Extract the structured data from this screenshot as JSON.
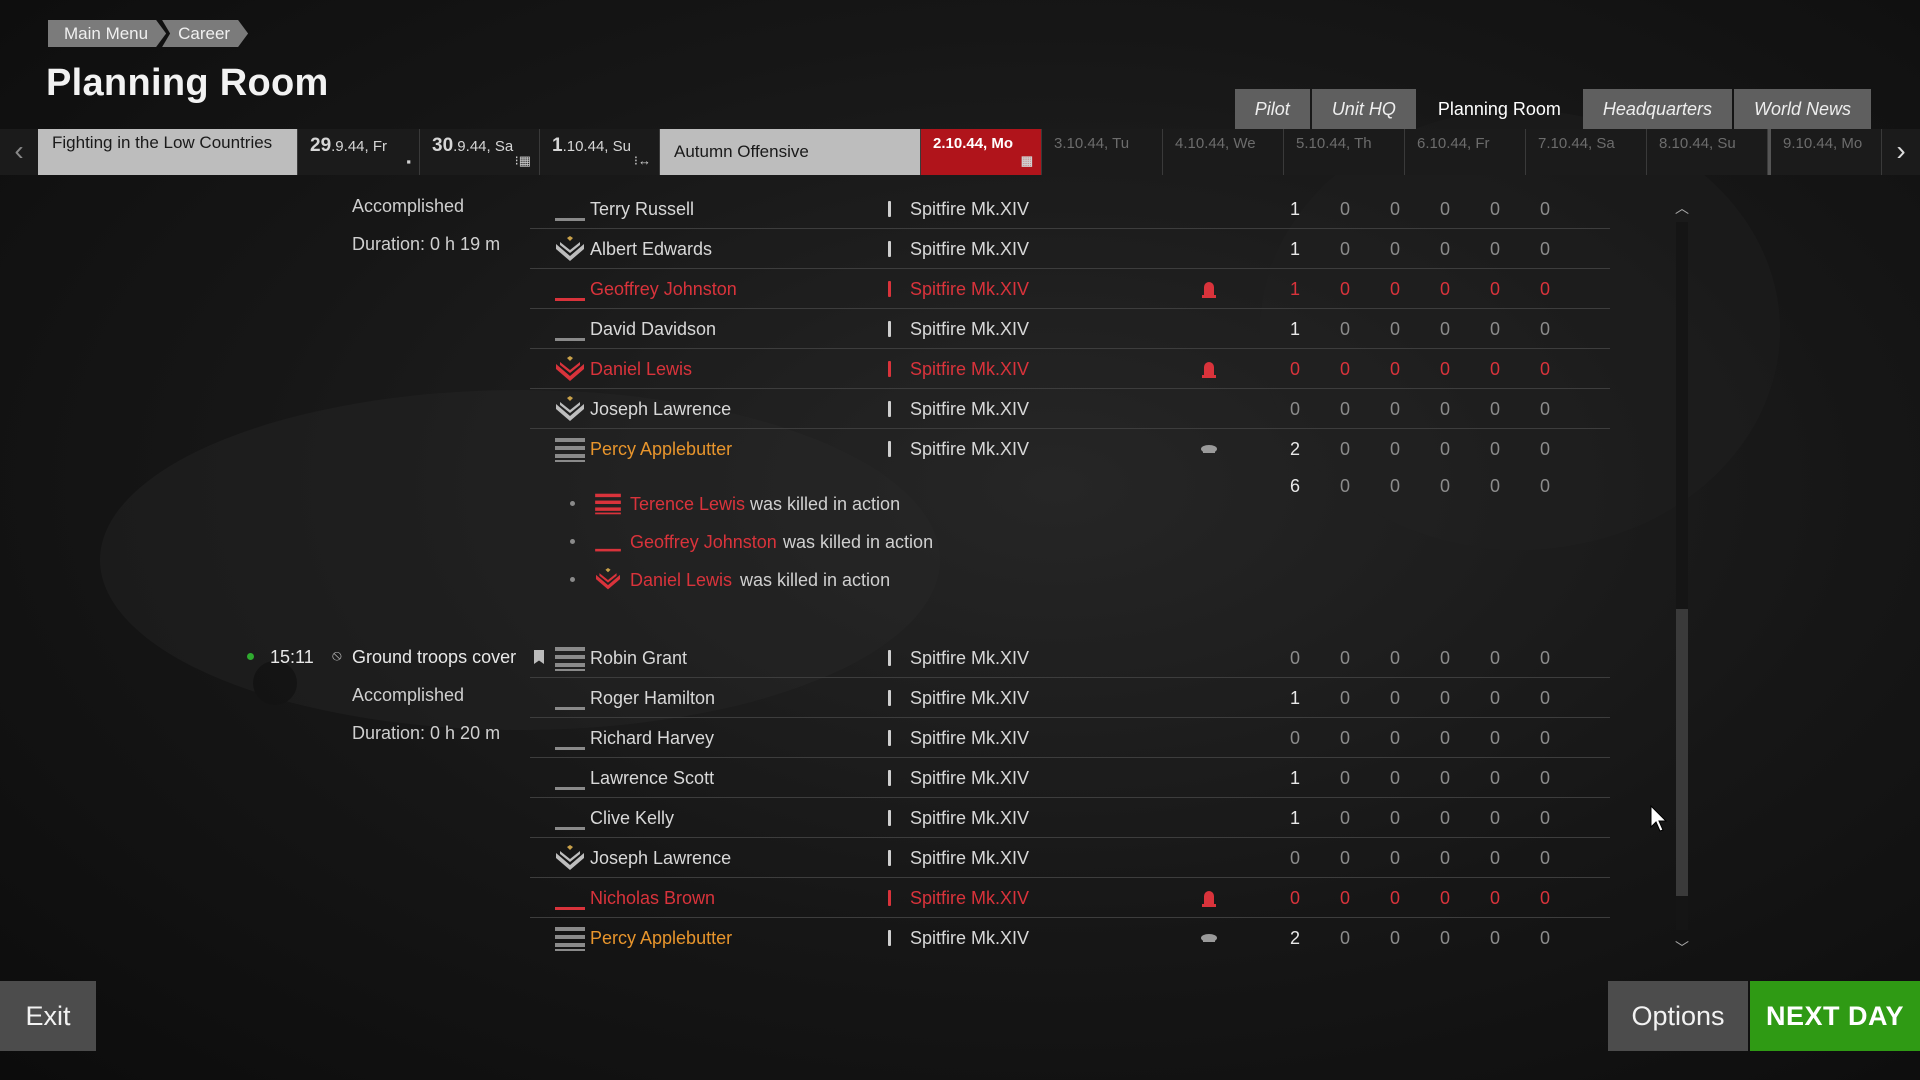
{
  "breadcrumb": [
    "Main Menu",
    "Career"
  ],
  "page_title": "Planning Room",
  "tabs": [
    "Pilot",
    "Unit HQ",
    "Planning Room",
    "Headquarters",
    "World News"
  ],
  "timeline": {
    "campaign_1": "Fighting in the Low Countries",
    "campaign_2": "Autumn Offensive",
    "dates": [
      {
        "day": "29",
        "rest": ".9.44, Fr"
      },
      {
        "day": "30",
        "rest": ".9.44, Sa"
      },
      {
        "day": "1",
        "rest": ".10.44, Su"
      },
      {
        "day": "2",
        "rest": ".10.44, Mo"
      },
      {
        "day": "3",
        "rest": ".10.44, Tu"
      },
      {
        "day": "4",
        "rest": ".10.44, We"
      },
      {
        "day": "5",
        "rest": ".10.44, Th"
      },
      {
        "day": "6",
        "rest": ".10.44, Fr"
      },
      {
        "day": "7",
        "rest": ".10.44, Sa"
      },
      {
        "day": "8",
        "rest": ".10.44, Su"
      },
      {
        "day": "9",
        "rest": ".10.44, Mo"
      }
    ]
  },
  "mission1": {
    "status": "Accomplished",
    "duration": "Duration: 0 h 19 m",
    "rows": [
      {
        "name": "Terry Russell",
        "plane": "Spitfire Mk.XIV",
        "v": [
          "1",
          "0",
          "0",
          "0",
          "0",
          "0"
        ]
      },
      {
        "name": "Albert Edwards",
        "plane": "Spitfire Mk.XIV",
        "v": [
          "1",
          "0",
          "0",
          "0",
          "0",
          "0"
        ]
      },
      {
        "name": "Geoffrey Johnston",
        "plane": "Spitfire Mk.XIV",
        "v": [
          "1",
          "0",
          "0",
          "0",
          "0",
          "0"
        ]
      },
      {
        "name": "David Davidson",
        "plane": "Spitfire Mk.XIV",
        "v": [
          "1",
          "0",
          "0",
          "0",
          "0",
          "0"
        ]
      },
      {
        "name": "Daniel Lewis",
        "plane": "Spitfire Mk.XIV",
        "v": [
          "0",
          "0",
          "0",
          "0",
          "0",
          "0"
        ]
      },
      {
        "name": "Joseph Lawrence",
        "plane": "Spitfire Mk.XIV",
        "v": [
          "0",
          "0",
          "0",
          "0",
          "0",
          "0"
        ]
      },
      {
        "name": "Percy Applebutter",
        "plane": "Spitfire Mk.XIV",
        "v": [
          "2",
          "0",
          "0",
          "0",
          "0",
          "0"
        ]
      }
    ],
    "totals": [
      "6",
      "0",
      "0",
      "0",
      "0",
      "0"
    ],
    "events": [
      {
        "name": "Terence Lewis",
        "text": "was killed in action"
      },
      {
        "name": "Geoffrey Johnston",
        "text": "was killed in action"
      },
      {
        "name": "Daniel Lewis",
        "text": "was killed in action"
      }
    ]
  },
  "mission2": {
    "time": "15:11",
    "type": "Ground troops cover",
    "status": "Accomplished",
    "duration": "Duration: 0 h 20 m",
    "rows": [
      {
        "name": "Robin Grant",
        "plane": "Spitfire Mk.XIV",
        "v": [
          "0",
          "0",
          "0",
          "0",
          "0",
          "0"
        ]
      },
      {
        "name": "Roger Hamilton",
        "plane": "Spitfire Mk.XIV",
        "v": [
          "1",
          "0",
          "0",
          "0",
          "0",
          "0"
        ]
      },
      {
        "name": "Richard Harvey",
        "plane": "Spitfire Mk.XIV",
        "v": [
          "0",
          "0",
          "0",
          "0",
          "0",
          "0"
        ]
      },
      {
        "name": "Lawrence Scott",
        "plane": "Spitfire Mk.XIV",
        "v": [
          "1",
          "0",
          "0",
          "0",
          "0",
          "0"
        ]
      },
      {
        "name": "Clive Kelly",
        "plane": "Spitfire Mk.XIV",
        "v": [
          "1",
          "0",
          "0",
          "0",
          "0",
          "0"
        ]
      },
      {
        "name": "Joseph Lawrence",
        "plane": "Spitfire Mk.XIV",
        "v": [
          "0",
          "0",
          "0",
          "0",
          "0",
          "0"
        ]
      },
      {
        "name": "Nicholas Brown",
        "plane": "Spitfire Mk.XIV",
        "v": [
          "0",
          "0",
          "0",
          "0",
          "0",
          "0"
        ]
      },
      {
        "name": "Percy Applebutter",
        "plane": "Spitfire Mk.XIV",
        "v": [
          "2",
          "0",
          "0",
          "0",
          "0",
          "0"
        ]
      }
    ]
  },
  "buttons": {
    "exit": "Exit",
    "options": "Options",
    "next_day": "NEXT DAY"
  },
  "colors": {
    "killed": "#d9333b",
    "player": "#e8952c",
    "current_day": "#b0141b",
    "next_day": "#2f9a14"
  }
}
